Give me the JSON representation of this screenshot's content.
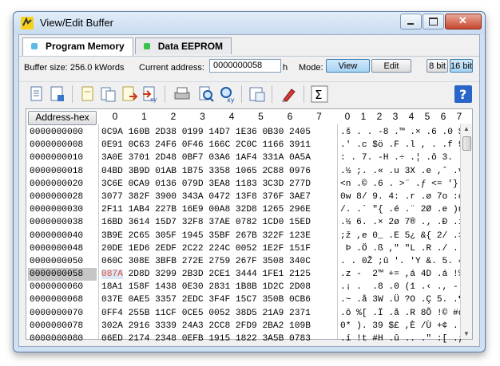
{
  "window": {
    "title": "View/Edit Buffer"
  },
  "tabs": [
    {
      "label": "Program Memory",
      "color": "#5fb9e8"
    },
    {
      "label": "Data EEPROM",
      "color": "#3cc24a"
    }
  ],
  "options": {
    "buffer_size": "Buffer size: 256.0 kWords",
    "current_address_label": "Current address:",
    "current_address_value": "0000000058",
    "address_suffix": "h",
    "mode_label": "Mode:",
    "view_label": "View",
    "edit_label": "Edit",
    "bit8_label": "8 bit",
    "bit16_label": "16 bit"
  },
  "grid": {
    "address_header": "Address-hex",
    "hex_columns": [
      "0",
      "1",
      "2",
      "3",
      "4",
      "5",
      "6",
      "7"
    ],
    "ascii_columns": [
      "0",
      "1",
      "2",
      "3",
      "4",
      "5",
      "6",
      "7"
    ],
    "selected_row": 11,
    "selected_col": 0,
    "rows": [
      {
        "addr": "0000000000",
        "hex": "0C9A 160B 2D38 0199 14D7 1E36 0B30 2405",
        "ascii": ".š . . -8 .™ .× .6 .0 $."
      },
      {
        "addr": "0000000008",
        "hex": "0E91 0C63 24F6 0F46 166C 2C0C 1166 3911",
        "ascii": ".' .c $ö .F .l , . .f 9."
      },
      {
        "addr": "0000000010",
        "hex": "3A0E 3701 2D48 0BF7 03A6 1AF4 331A 0A5A",
        "ascii": ": . 7. -H .÷ .¦ .ô 3. .Z"
      },
      {
        "addr": "0000000018",
        "hex": "04BD 3B9D 01AB 1B75 3358 1065 2C88 0976",
        "ascii": ".½ ;. .« .u 3X .e ,ˆ .v"
      },
      {
        "addr": "0000000020",
        "hex": "3C6E 0CA9 0136 079D 3EA8 1183 3C3D 277D",
        "ascii": "<n .© .6 . >¨ .ƒ <= '}"
      },
      {
        "addr": "0000000028",
        "hex": "3077 382F 3900 343A 0472 13F8 376F 3AE7",
        "ascii": "0w 8/ 9. 4: .r .ø 7o :ç"
      },
      {
        "addr": "0000000030",
        "hex": "2F11 1AB4 227B 16E9 00A8 32D8 1265 296E",
        "ascii": "/. .´ \"{ .é .¨ 2Ø .e )n"
      },
      {
        "addr": "0000000038",
        "hex": "16BD 3614 15D7 32F8 37AE 0782 1CD0 15ED",
        "ascii": ".½ 6. .× 2ø 7® .‚ .Ð .í"
      },
      {
        "addr": "0000000040",
        "hex": "3B9E 2C65 305F 1945 35BF 267B 322F 123E",
        "ascii": ";ž ,e 0_ .E 5¿ &{ 2/ .>"
      },
      {
        "addr": "0000000048",
        "hex": "20DE 1ED6 2EDF 2C22 224C 0052 1E2F 151F",
        "ascii": " Þ .Ö .ß ,\" \"L .R ./ .."
      },
      {
        "addr": "0000000050",
        "hex": "060C 308E 3BFB 272E 2759 267F 3508 340C",
        "ascii": ". . 0Ž ;û '. 'Y &. 5. 4."
      },
      {
        "addr": "0000000058",
        "hex": "087A 2D8D 3299 2B3D 2CE1 3444 1FE1 2125",
        "ascii": ".z -  2™ += ,á 4D .á !%"
      },
      {
        "addr": "0000000060",
        "hex": "18A1 158F 1438 0E30 2831 1B8B 1D2C 2D08",
        "ascii": ".¡ .  .8 .0 (1 .‹ ., -."
      },
      {
        "addr": "0000000068",
        "hex": "037E 0AE5 3357 2EDC 3F4F 15C7 350B 0CB6",
        "ascii": ".~ .å 3W .Ü ?O .Ç 5. .¶"
      },
      {
        "addr": "0000000070",
        "hex": "0FF4 255B 11CF 0CE5 0052 38D5 21A9 2371",
        "ascii": ".ô %[ .Ï .å .R 8Õ !© #q"
      },
      {
        "addr": "0000000078",
        "hex": "302A 2916 3339 24A3 2CC8 2FD9 2BA2 109B",
        "ascii": "0* ). 39 $£ ,È /Ù +¢ .›"
      },
      {
        "addr": "0000000080",
        "hex": "06ED 2174 2348 0EFB 1915 1822 3A5B 0783",
        "ascii": ".í !t #H .û .. .\" :[ .ƒ"
      }
    ]
  },
  "toolbar_icons": [
    "open-file-icon",
    "save-file-icon",
    "copy-icon",
    "paste-icon",
    "import-icon",
    "export-xy-icon",
    "print-icon",
    "find-icon",
    "find-xy-icon",
    "buffer-props-icon",
    "fill-icon",
    "checksum-sigma-icon",
    "help-icon"
  ]
}
